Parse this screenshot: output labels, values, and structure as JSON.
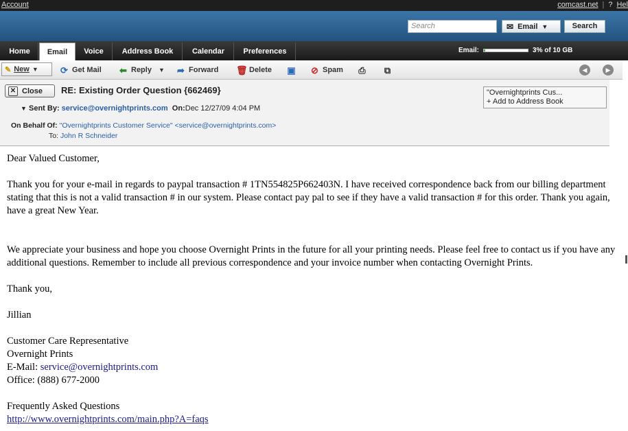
{
  "topbar": {
    "account": "Account",
    "domain": "comcast.net",
    "help": "Hel"
  },
  "header": {
    "search_placeholder": "Search",
    "search_scope": "Email",
    "search_button": "Search"
  },
  "tabs": [
    {
      "label": "Home"
    },
    {
      "label": "Email",
      "active": true
    },
    {
      "label": "Voice"
    },
    {
      "label": "Address Book"
    },
    {
      "label": "Calendar"
    },
    {
      "label": "Preferences"
    }
  ],
  "quota": {
    "label": "Email:",
    "text": "3% of 10 GB",
    "fraction": 0.03
  },
  "toolbar": {
    "new": "New",
    "get_mail": "Get Mail",
    "reply": "Reply",
    "forward": "Forward",
    "delete": "Delete",
    "spam": "Spam"
  },
  "message": {
    "close": "Close",
    "subject": "RE: Existing Order Question {662469}",
    "sent_by_label": "Sent By:",
    "sent_by": "service@overnightprints.com",
    "on_label": "On:",
    "date": "Dec 12/27/09 4:04 PM",
    "behalf_label": "On Behalf Of:",
    "behalf": "\"Overnightprints Customer Service\" <service@overnightprints.com>",
    "to_label": "To:",
    "to": "John R Schneider",
    "sender_card_name": "\"Overnightprints Cus...",
    "sender_card_add": "+ Add to Address Book"
  },
  "body": {
    "greeting": "Dear Valued Customer,",
    "para1": "Thank you for your e-mail in regards to paypal transaction # 1TN554825P662403N. I have received correspondence back from our billing department stating that this is not a valid transaction # in our system. Please contact pay pal to see if they have a valid transaction # for this order. Thank you again, have a great New Year.",
    "para2": "We appreciate your business and hope you choose Overnight Prints in the future for all your printing needs. Please feel free to contact us if you have any additional questions. Remember to include all previous correspondence and your invoice number when contacting Overnight Prints.",
    "thanks": "Thank you,",
    "name": "Jillian",
    "title": "Customer Care Representative",
    "company": "Overnight Prints",
    "email_label": "E-Mail:",
    "email": "service@overnightprints.com",
    "office": "Office: (888) 677-2000",
    "faq_label": "Frequently Asked Questions",
    "faq_url": "http://www.overnightprints.com/main.php?A=faqs"
  }
}
